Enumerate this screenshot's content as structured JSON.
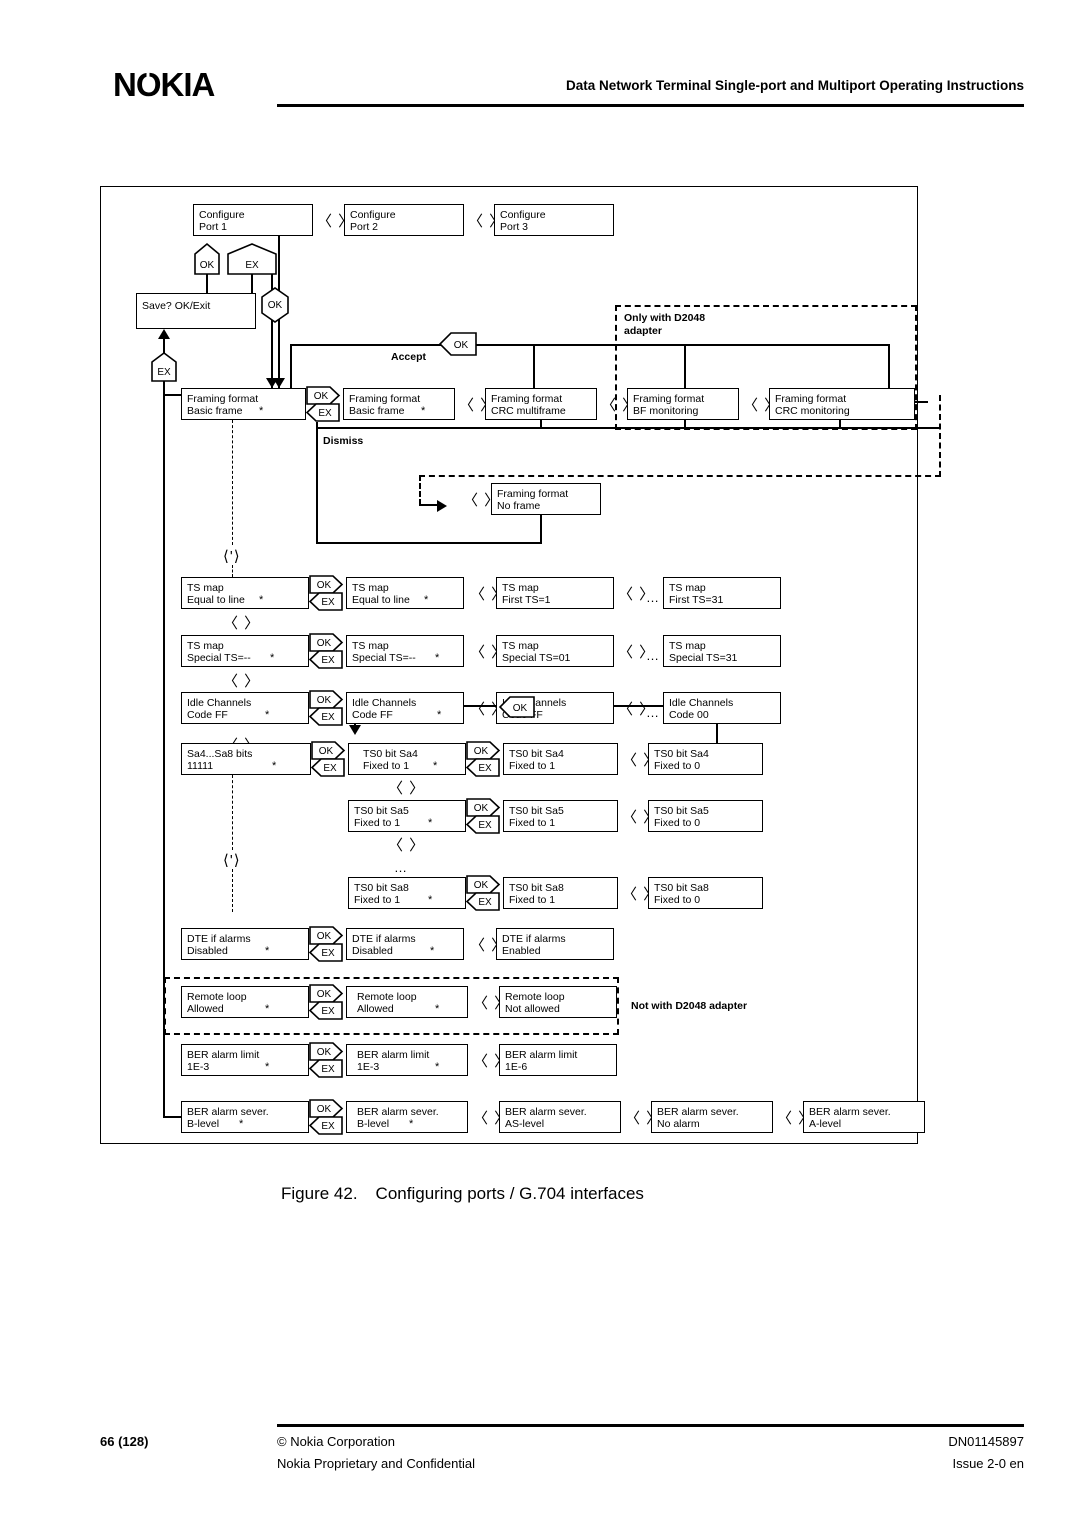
{
  "header": {
    "logo": "NOKIA",
    "title": "Data Network Terminal Single-port and Multiport Operating Instructions"
  },
  "caption": {
    "number": "Figure 42.",
    "text": "Configuring ports / G.704 interfaces"
  },
  "footer": {
    "page": "66 (128)",
    "copyright": "© Nokia Corporation",
    "confidential": "Nokia Proprietary and Confidential",
    "doc_id": "DN01145897",
    "issue": "Issue 2-0 en"
  },
  "diagram": {
    "title": "Configuring ports / G.704 interfaces menu tree",
    "keys": {
      "ok": "OK",
      "ex": "EX"
    },
    "nav_glyph": "〈 〉",
    "ellipsis": "…",
    "labels": {
      "accept": "Accept",
      "dismiss": "Dismiss",
      "only_d2048": "Only with D2048",
      "only_d2048_2": "adapter",
      "not_d2048": "Not with D2048 adapter"
    },
    "rows": {
      "ports": [
        {
          "l1": "Configure",
          "l2": "Port 1"
        },
        {
          "l1": "Configure",
          "l2": "Port 2"
        },
        {
          "l1": "Configure",
          "l2": "Port 3"
        }
      ],
      "save": {
        "l1": "Save? OK/Exit",
        "l2": ""
      },
      "framing": [
        {
          "l1": "Framing format",
          "l2": "Basic frame",
          "star": "*"
        },
        {
          "l1": "Framing format",
          "l2": "Basic frame",
          "star": "*"
        },
        {
          "l1": "Framing format",
          "l2": "CRC multiframe"
        },
        {
          "l1": "Framing format",
          "l2": "BF monitoring"
        },
        {
          "l1": "Framing format",
          "l2": "CRC monitoring"
        }
      ],
      "noframe": {
        "l1": "Framing format",
        "l2": "No frame"
      },
      "tsmap": [
        {
          "l1": "TS map",
          "l2": "Equal to line",
          "star": "*"
        },
        {
          "l1": "TS map",
          "l2": "Equal to line",
          "star": "*"
        },
        {
          "l1": "TS map",
          "l2": "First TS=1"
        },
        {
          "l1": "TS map",
          "l2": "First TS=31"
        }
      ],
      "tsmap_special": [
        {
          "l1": "TS map",
          "l2": "Special TS=--",
          "star": "*"
        },
        {
          "l1": "TS map",
          "l2": "Special TS=--",
          "star": "*"
        },
        {
          "l1": "TS map",
          "l2": "Special TS=01"
        },
        {
          "l1": "TS map",
          "l2": "Special TS=31"
        }
      ],
      "idle": [
        {
          "l1": "Idle Channels",
          "l2": "Code FF",
          "star": "*"
        },
        {
          "l1": "Idle Channels",
          "l2": "Code FF",
          "star": "*"
        },
        {
          "l1": "Idle Channels",
          "l2": "Code FF"
        },
        {
          "l1": "Idle Channels",
          "l2": "Code 00"
        }
      ],
      "sa_bits": {
        "l1": "Sa4...Sa8 bits",
        "l2": "11111",
        "star": "*"
      },
      "sa4": [
        {
          "l1": "TS0 bit Sa4",
          "l2": "Fixed to 1",
          "star": "*"
        },
        {
          "l1": "TS0 bit Sa4",
          "l2": "Fixed to 1"
        },
        {
          "l1": "TS0 bit Sa4",
          "l2": "Fixed to 0"
        }
      ],
      "sa5": [
        {
          "l1": "TS0 bit Sa5",
          "l2": "Fixed to 1",
          "star": "*"
        },
        {
          "l1": "TS0 bit Sa5",
          "l2": "Fixed to 1"
        },
        {
          "l1": "TS0 bit Sa5",
          "l2": "Fixed to 0"
        }
      ],
      "sa8": [
        {
          "l1": "TS0 bit Sa8",
          "l2": "Fixed to 1",
          "star": "*"
        },
        {
          "l1": "TS0 bit Sa8",
          "l2": "Fixed to 1"
        },
        {
          "l1": "TS0 bit Sa8",
          "l2": "Fixed to 0"
        }
      ],
      "dte": [
        {
          "l1": "DTE if alarms",
          "l2": "Disabled",
          "star": "*"
        },
        {
          "l1": "DTE if alarms",
          "l2": "Disabled",
          "star": "*"
        },
        {
          "l1": "DTE if alarms",
          "l2": "Enabled"
        }
      ],
      "remote": [
        {
          "l1": "Remote loop",
          "l2": "Allowed",
          "star": "*"
        },
        {
          "l1": "Remote loop",
          "l2": "Allowed",
          "star": "*"
        },
        {
          "l1": "Remote loop",
          "l2": "Not allowed"
        }
      ],
      "ber_limit": [
        {
          "l1": "BER alarm limit",
          "l2": "1E-3",
          "star": "*"
        },
        {
          "l1": "BER alarm limit",
          "l2": "1E-3",
          "star": "*"
        },
        {
          "l1": "BER alarm limit",
          "l2": "1E-6"
        }
      ],
      "ber_sever": [
        {
          "l1": "BER alarm sever.",
          "l2": "B-level",
          "star": "*"
        },
        {
          "l1": "BER alarm sever.",
          "l2": "B-level",
          "star": "*"
        },
        {
          "l1": "BER alarm sever.",
          "l2": "AS-level"
        },
        {
          "l1": "BER alarm sever.",
          "l2": "No alarm"
        },
        {
          "l1": "BER alarm sever.",
          "l2": "A-level"
        }
      ]
    }
  }
}
